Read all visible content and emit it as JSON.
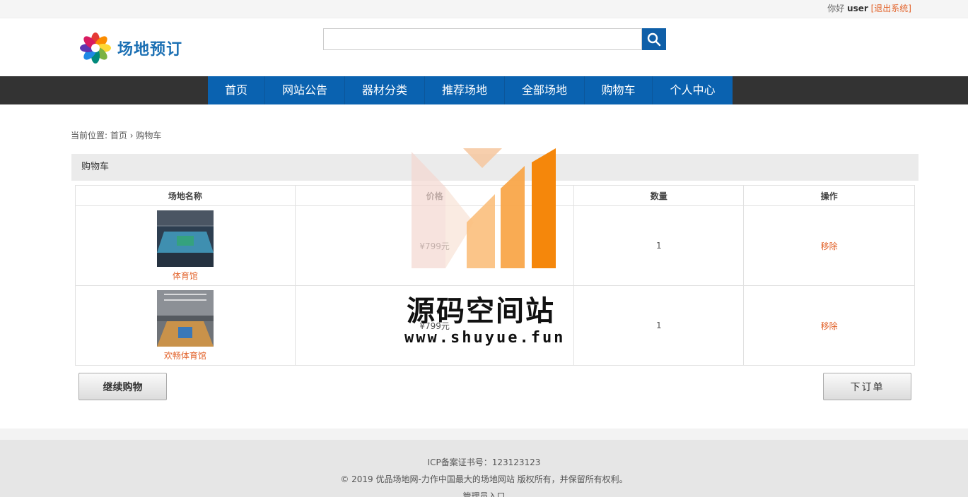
{
  "topbar": {
    "greeting": "你好",
    "username": "user",
    "logout": "[退出系统]"
  },
  "header": {
    "logo_text": "场地预订",
    "search_placeholder": ""
  },
  "nav": {
    "items": [
      "首页",
      "网站公告",
      "器材分类",
      "推荐场地",
      "全部场地",
      "购物车",
      "个人中心"
    ]
  },
  "breadcrumb": {
    "prefix": "当前位置:",
    "home": "首页",
    "sep": "›",
    "current": "购物车"
  },
  "panel": {
    "title": "购物车"
  },
  "table": {
    "headers": [
      "场地名称",
      "价格",
      "数量",
      "操作"
    ],
    "rows": [
      {
        "name": "体育馆",
        "price": "¥799元",
        "qty": "1",
        "action": "移除"
      },
      {
        "name": "欢畅体育馆",
        "price": "¥799元",
        "qty": "1",
        "action": "移除"
      }
    ]
  },
  "buttons": {
    "continue": "继续购物",
    "order": "下订单"
  },
  "footer": {
    "icp": "ICP备案证书号：123123123",
    "copyright": "© 2019 优品场地网-力作中国最大的场地网站 版权所有，并保留所有权利。",
    "admin": "管理员入口"
  },
  "watermark": {
    "title": "源码空间站",
    "url": "www.shuyue.fun"
  },
  "colors": {
    "nav_blue": "#0a62b0",
    "accent_orange": "#e2632b",
    "nav_bar": "#333333"
  }
}
